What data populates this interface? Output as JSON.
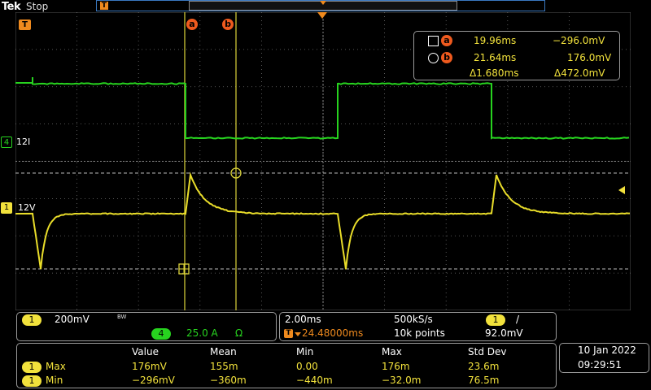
{
  "header": {
    "brand": "Tek",
    "state": "Stop",
    "trigger_marker_label": "T"
  },
  "colors": {
    "ch1": "#e9dd2a",
    "ch4": "#27d31f",
    "cursor": "#ef5a1e",
    "cursor_line": "#ddd53a",
    "grid": "#6e6e6e"
  },
  "cursors": {
    "a_label": "a",
    "b_label": "b",
    "a_time": "19.96ms",
    "a_value": "−296.0mV",
    "b_time": "21.64ms",
    "b_value": "176.0mV",
    "delta_time": "Δ1.680ms",
    "delta_value": "Δ472.0mV"
  },
  "channels": {
    "ch4": {
      "number": "4",
      "label": "12I",
      "scale": "25.0 A",
      "unit_icon": "Ω"
    },
    "ch1": {
      "number": "1",
      "label": "12V",
      "scale": "200mV",
      "bw_icon": "BW"
    }
  },
  "horizontal": {
    "time_div": "2.00ms",
    "sample_rate": "500kS/s",
    "trigger_pos": "24.48000ms",
    "record_length": "10k points",
    "trig_source": "1",
    "trig_slope": "/",
    "trig_level": "92.0mV"
  },
  "measurements": {
    "headers": [
      "Value",
      "Mean",
      "Min",
      "Max",
      "Std Dev"
    ],
    "rows": [
      {
        "ch": "1",
        "name": "Max",
        "cells": [
          "176mV",
          "155m",
          "0.00",
          "176m",
          "23.6m"
        ]
      },
      {
        "ch": "1",
        "name": "Min",
        "cells": [
          "−296mV",
          "−360m",
          "−440m",
          "−32.0m",
          "76.5m"
        ]
      }
    ]
  },
  "clock": {
    "date": "10 Jan  2022",
    "time": "09:29:51"
  }
}
